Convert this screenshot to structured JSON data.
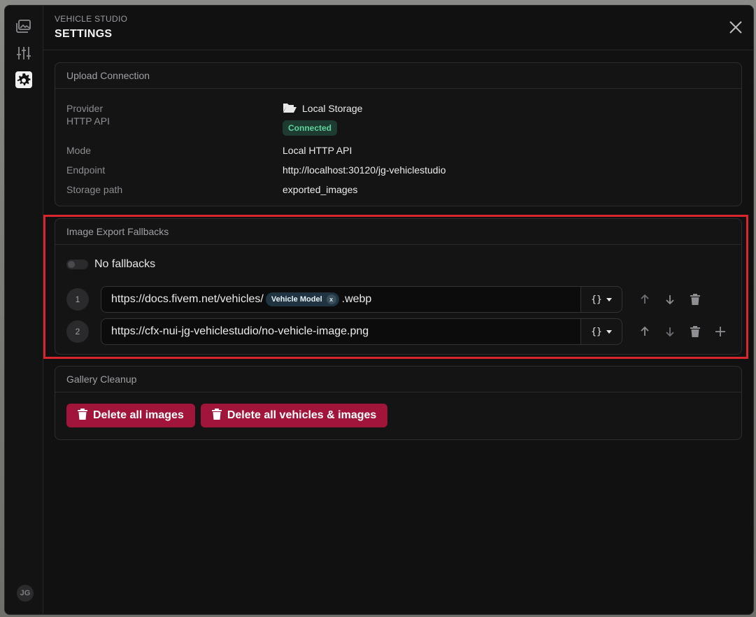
{
  "header": {
    "eyebrow": "VEHICLE STUDIO",
    "title": "SETTINGS"
  },
  "sidebar": {
    "items": [
      {
        "name": "gallery-icon",
        "active": false
      },
      {
        "name": "sliders-icon",
        "active": false
      },
      {
        "name": "gear-icon",
        "active": true
      }
    ],
    "avatar": "JG"
  },
  "upload": {
    "title": "Upload Connection",
    "rows": [
      {
        "key": "Provider",
        "value": "Local Storage",
        "icon": "folder-open-icon"
      },
      {
        "key": "HTTP API",
        "value": "Connected",
        "badge": true
      },
      {
        "key": "Mode",
        "value": "Local HTTP API"
      },
      {
        "key": "Endpoint",
        "value": "http://localhost:30120/jg-vehiclestudio"
      },
      {
        "key": "Storage path",
        "value": "exported_images"
      }
    ]
  },
  "fallbacks": {
    "title": "Image Export Fallbacks",
    "toggle_label": "No fallbacks",
    "toggle_on": false,
    "var_label": "{}",
    "items": [
      {
        "num": "1",
        "prefix": "https://docs.fivem.net/vehicles/",
        "chip": "Vehicle Model",
        "chip_x": "x",
        "suffix": ".webp"
      },
      {
        "num": "2",
        "prefix": "https://cfx-nui-jg-vehiclestudio/no-vehicle-image.png",
        "chip": "",
        "suffix": ""
      }
    ]
  },
  "cleanup": {
    "title": "Gallery Cleanup",
    "delete_images": "Delete all images",
    "delete_all": "Delete all vehicles & images"
  },
  "colors": {
    "danger": "#a2153b",
    "connected_bg": "#1d3b30",
    "connected_fg": "#5fd49c",
    "highlight": "#d8262c"
  }
}
